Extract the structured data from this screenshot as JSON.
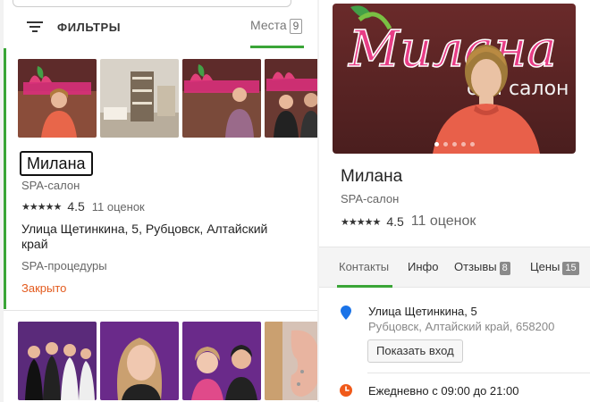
{
  "filters": {
    "label": "ФИЛЬТРЫ"
  },
  "places_tab": {
    "label": "Места",
    "count": "9"
  },
  "listing": {
    "name": "Милана",
    "category": "SPA-салон",
    "stars": "★★★★★",
    "rating": "4.5",
    "reviews": "11 оценок",
    "address": "Улица Щетинкина, 5, Рубцовск, Алтайский край",
    "services": "SPA-процедуры",
    "status": "Закрыто"
  },
  "details": {
    "name": "Милана",
    "category": "SPA-салон",
    "stars": "★★★★★",
    "rating": "4.5",
    "reviews": "11 оценок",
    "tabs": [
      {
        "label": "Контакты"
      },
      {
        "label": "Инфо"
      },
      {
        "label": "Отзывы",
        "count": "8"
      },
      {
        "label": "Цены",
        "count": "15"
      }
    ],
    "address_line1": "Улица Щетинкина, 5",
    "address_line2": "Рубцовск, Алтайский край, 658200",
    "show_entrance": "Показать вход",
    "hours": "Ежедневно с 09:00 до 21:00"
  },
  "colors": {
    "accent": "#3aa537",
    "closed": "#e35a1d",
    "pin": "#1a73e8",
    "clock": "#f05a1a"
  }
}
